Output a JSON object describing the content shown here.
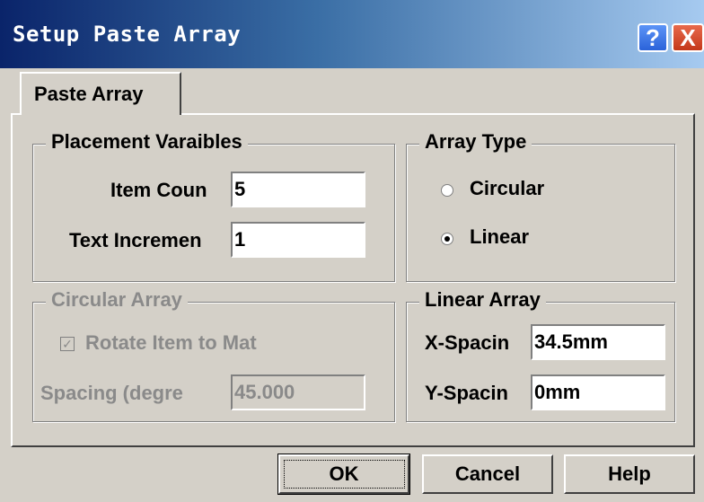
{
  "window": {
    "title": "Setup Paste Array",
    "help_glyph": "?",
    "close_glyph": "X"
  },
  "tabs": [
    {
      "label": "Paste Array"
    }
  ],
  "placement": {
    "legend": "Placement Varaibles",
    "item_count_label": "Item Coun",
    "item_count_value": "5",
    "text_increment_label": "Text Incremen",
    "text_increment_value": "1"
  },
  "array_type": {
    "legend": "Array Type",
    "options": [
      {
        "label": "Circular",
        "selected": false
      },
      {
        "label": "Linear",
        "selected": true
      }
    ]
  },
  "circular": {
    "legend": "Circular Array",
    "rotate_label": "Rotate Item to Mat",
    "rotate_checked": true,
    "spacing_label": "Spacing (degre",
    "spacing_value": "45.000"
  },
  "linear": {
    "legend": "Linear Array",
    "x_label": "X-Spacin",
    "x_value": "34.5mm",
    "y_label": "Y-Spacin",
    "y_value": "0mm"
  },
  "buttons": {
    "ok": "OK",
    "cancel": "Cancel",
    "help": "Help"
  },
  "icons": {
    "radio_dot": "radio-dot",
    "check": "✓"
  }
}
